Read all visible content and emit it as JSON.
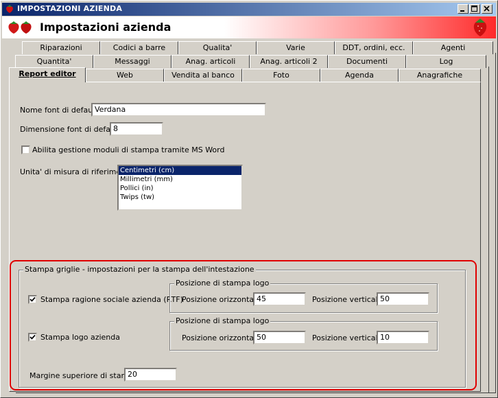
{
  "window": {
    "title": "IMPOSTAZIONI AZIENDA"
  },
  "header": {
    "title": "Impostazioni azienda"
  },
  "tabs": {
    "row1": [
      "Riparazioni",
      "Codici a barre",
      "Qualita'",
      "Varie",
      "DDT, ordini, ecc.",
      "Agenti"
    ],
    "row2": [
      "Quantita'",
      "Messaggi",
      "Anag. articoli",
      "Anag. articoli 2",
      "Documenti",
      "Log"
    ],
    "row3": [
      "Report editor",
      "Web",
      "Vendita al banco",
      "Foto",
      "Agenda",
      "Anagrafiche"
    ],
    "active": "Report editor"
  },
  "form": {
    "font_name_label": "Nome font di default",
    "font_name_value": "Verdana",
    "font_size_label": "Dimensione font di default",
    "font_size_value": "8",
    "word_checkbox_label": "Abilita gestione moduli di stampa tramite MS Word",
    "word_checkbox_checked": false,
    "units_label": "Unita' di misura di riferimento",
    "units_options": [
      "Centimetri (cm)",
      "Millimetri (mm)",
      "Pollici (in)",
      "Twips (tw)"
    ],
    "units_selected": "Centimetri (cm)"
  },
  "print_group": {
    "title": "Stampa griglie - impostazioni per la stampa dell'intestazione",
    "ragione_sociale": {
      "label": "Stampa ragione sociale azienda (RTF)",
      "checked": true,
      "group_title": "Posizione di stampa logo",
      "horiz_label": "Posizione orizzontale",
      "horiz_value": "45",
      "vert_label": "Posizione verticale",
      "vert_value": "50"
    },
    "logo": {
      "label": "Stampa logo azienda",
      "checked": true,
      "group_title": "Posizione di stampa logo",
      "horiz_label": "Posizione orizzontale",
      "horiz_value": "50",
      "vert_label": "Posizione verticale",
      "vert_value": "10"
    },
    "margin_label": "Margine superiore di stampa",
    "margin_value": "20"
  },
  "colors": {
    "titlebar": "#0a246a",
    "highlight": "#e00000",
    "selection": "#0a246a"
  }
}
